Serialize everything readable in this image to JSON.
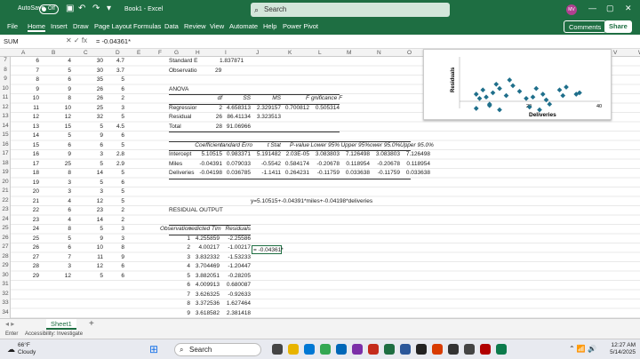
{
  "titlebar": {
    "autosave": "AutoSave",
    "toggle": "Off",
    "title": "Book1 - Excel",
    "search_placeholder": "Search",
    "avatar": "MV"
  },
  "ribbon": {
    "tabs": [
      "File",
      "Home",
      "Insert",
      "Draw",
      "Page Layout",
      "Formulas",
      "Data",
      "Review",
      "View",
      "Automate",
      "Help",
      "Power Pivot"
    ],
    "comments": "Comments",
    "share": "Share"
  },
  "formula_bar": {
    "name_box": "SUM",
    "formula": "= -0.04361*"
  },
  "columns": [
    "A",
    "B",
    "C",
    "D",
    "E",
    "F",
    "G",
    "H",
    "I",
    "J",
    "K",
    "L",
    "M",
    "N",
    "O",
    "P",
    "Q",
    "R",
    "S",
    "T",
    "U",
    "V",
    "W"
  ],
  "rows": [
    "7",
    "8",
    "9",
    "10",
    "11",
    "12",
    "13",
    "14",
    "15",
    "16",
    "17",
    "18",
    "19",
    "20",
    "21",
    "22",
    "23",
    "24",
    "25",
    "26",
    "27",
    "28",
    "29",
    "30",
    "31",
    "32",
    "33",
    "34",
    "35",
    "36"
  ],
  "left_data": [
    [
      "6",
      "4",
      "30",
      "4.7"
    ],
    [
      "7",
      "5",
      "30",
      "3.7"
    ],
    [
      "8",
      "6",
      "35",
      "5"
    ],
    [
      "9",
      "9",
      "26",
      "6"
    ],
    [
      "10",
      "8",
      "26",
      "2"
    ],
    [
      "11",
      "10",
      "25",
      "3"
    ],
    [
      "12",
      "12",
      "32",
      "5"
    ],
    [
      "13",
      "15",
      "5",
      "4.5"
    ],
    [
      "14",
      "5",
      "9",
      "6"
    ],
    [
      "15",
      "6",
      "6",
      "5"
    ],
    [
      "16",
      "9",
      "3",
      "2.8"
    ],
    [
      "17",
      "25",
      "5",
      "2.9"
    ],
    [
      "18",
      "8",
      "14",
      "5"
    ],
    [
      "19",
      "3",
      "5",
      "6"
    ],
    [
      "20",
      "3",
      "3",
      "5"
    ],
    [
      "21",
      "4",
      "12",
      "5"
    ],
    [
      "22",
      "6",
      "23",
      "2"
    ],
    [
      "23",
      "4",
      "14",
      "2"
    ],
    [
      "24",
      "8",
      "5",
      "3"
    ],
    [
      "25",
      "5",
      "9",
      "3"
    ],
    [
      "26",
      "6",
      "10",
      "8"
    ],
    [
      "27",
      "7",
      "11",
      "9"
    ],
    [
      "28",
      "3",
      "12",
      "6"
    ],
    [
      "29",
      "12",
      "5",
      "6"
    ]
  ],
  "regression": {
    "standard_error": [
      "Standard E",
      "1.837871"
    ],
    "observations": [
      "Observatio",
      "29"
    ],
    "anova_label": "ANOVA",
    "anova_header": [
      "",
      "df",
      "SS",
      "MS",
      "F",
      "gnificance F"
    ],
    "anova_rows": [
      [
        "Regressior",
        "2",
        "4.658313",
        "2.329157",
        "0.700812",
        "0.505314"
      ],
      [
        "Residual",
        "26",
        "86.41134",
        "3.323513",
        "",
        ""
      ],
      [
        "Total",
        "28",
        "91.06966",
        "",
        "",
        ""
      ]
    ],
    "coef_header": [
      "",
      "Coefficient",
      "tandard Erro",
      "t Stat",
      "P-value",
      "Lower 95%",
      "Upper 95%",
      "ower 95.0%",
      "Upper 95.0%"
    ],
    "coef_rows": [
      [
        "Intercept",
        "5.10515",
        "0.983371",
        "5.191482",
        "2.03E-05",
        "3.083803",
        "7.126498",
        "3.083803",
        "7.126498"
      ],
      [
        "Miles",
        "-0.04391",
        "0.079033",
        "-0.5542",
        "0.584174",
        "-0.20678",
        "0.118954",
        "-0.20678",
        "0.118954"
      ],
      [
        "Deliveries",
        "-0.04198",
        "0.036785",
        "-1.1411",
        "0.264231",
        "-0.11759",
        "0.033638",
        "-0.11759",
        "0.033638"
      ]
    ],
    "equation": "y=5.10515+-0.04391*miles+-0.04198*deliveries",
    "cell_edit": "= -0.04361*"
  },
  "residual": {
    "title": "RESIDUAL OUTPUT",
    "header": [
      "Observation",
      "redicted Tim",
      "Residuals"
    ],
    "rows": [
      [
        "1",
        "4.255859",
        "-2.25586"
      ],
      [
        "2",
        "4.00217",
        "-1.00217"
      ],
      [
        "3",
        "3.832332",
        "-1.53233"
      ],
      [
        "4",
        "3.704469",
        "-1.20447"
      ],
      [
        "5",
        "3.882051",
        "-0.28205"
      ],
      [
        "6",
        "4.009913",
        "0.680087"
      ],
      [
        "7",
        "3.626325",
        "-0.92633"
      ],
      [
        "8",
        "3.372536",
        "1.627464"
      ],
      [
        "9",
        "3.618582",
        "2.381418"
      ],
      [
        "10",
        "3.662494",
        "-1.66249"
      ],
      [
        "11",
        "3.616646",
        "-0.61665"
      ],
      [
        "12",
        "3.234994",
        "1.765006"
      ]
    ]
  },
  "chart": {
    "y_axis_label": "Residuals",
    "x_axis_label": "Deliveries",
    "x_ticks": [
      "20",
      "40"
    ]
  },
  "chart_data": {
    "type": "scatter",
    "xlabel": "Deliveries",
    "ylabel": "Residuals",
    "x": [
      5,
      9,
      7,
      8,
      12,
      14,
      11,
      12,
      5,
      6,
      9,
      10,
      15,
      16,
      18,
      20,
      21,
      22,
      23,
      24,
      25,
      26,
      27,
      30,
      31,
      32,
      35,
      36
    ],
    "y": [
      0.5,
      -0.2,
      0.8,
      0.3,
      -0.6,
      0.4,
      1.2,
      0.9,
      -0.5,
      0.2,
      -0.3,
      0.6,
      1.5,
      1.1,
      0.7,
      0.2,
      -0.4,
      0.3,
      0.9,
      -0.6,
      0.5,
      0.1,
      -0.2,
      0.8,
      0.4,
      1.0,
      0.5,
      0.6
    ],
    "x_ticks": [
      "20",
      "40"
    ]
  },
  "sheet_tab": "Sheet1",
  "status": {
    "enter": "Enter",
    "accessibility": "Accessibility: Investigate"
  },
  "taskbar": {
    "weather_temp": "66°F",
    "weather_desc": "Cloudy",
    "search": "Search",
    "time": "12:27 AM",
    "date": "5/14/2025"
  }
}
